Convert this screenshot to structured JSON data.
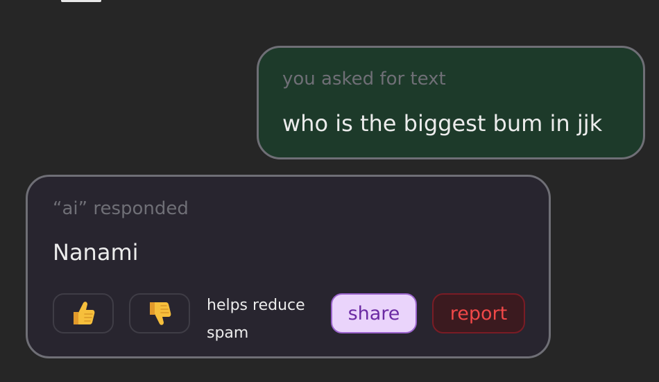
{
  "user_message": {
    "caption": "you asked for text",
    "text": "who is the biggest bum in jjk"
  },
  "ai_message": {
    "caption": "“ai” responded",
    "text": "Nanami"
  },
  "actions": {
    "thumbs_up_icon": "thumbs-up-icon",
    "thumbs_down_icon": "thumbs-down-icon",
    "spam_note": "helps reduce spam",
    "share_label": "share",
    "report_label": "report"
  },
  "colors": {
    "background": "#262626",
    "user_bubble": "#1d3a2a",
    "ai_bubble": "#28252f",
    "bubble_border": "#6f6f76",
    "share_bg": "#ead4fb",
    "share_text": "#6b2aa3",
    "report_bg": "#3b1a1f",
    "report_text": "#f04848"
  }
}
